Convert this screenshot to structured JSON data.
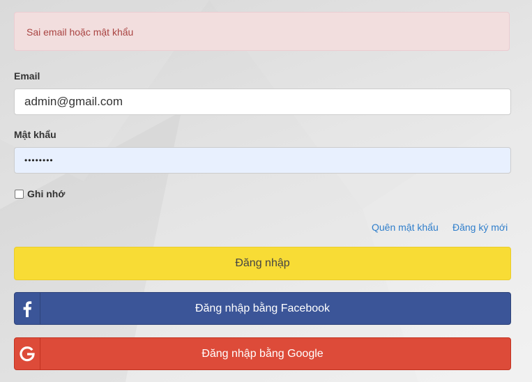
{
  "alert": {
    "message": "Sai email hoặc mật khẩu"
  },
  "form": {
    "email": {
      "label": "Email",
      "value": "admin@gmail.com"
    },
    "password": {
      "label": "Mật khẩu",
      "masked_value": "••••••••"
    },
    "remember": {
      "label": "Ghi nhớ",
      "checked": false
    }
  },
  "links": {
    "forgot_password": "Quên mật khẩu",
    "register": "Đăng ký mới"
  },
  "buttons": {
    "login": "Đăng nhập",
    "facebook": "Đăng nhập bằng Facebook",
    "google": "Đăng nhập bằng Google"
  },
  "colors": {
    "alert_bg": "#f2dede",
    "alert_text": "#a94442",
    "login_button": "#f8dc35",
    "facebook_button": "#3b5598",
    "google_button": "#dd4b39",
    "link": "#2f7ecb",
    "password_autofill_bg": "#e8f0fe"
  },
  "icons": {
    "facebook": "facebook-icon",
    "google": "google-icon"
  }
}
